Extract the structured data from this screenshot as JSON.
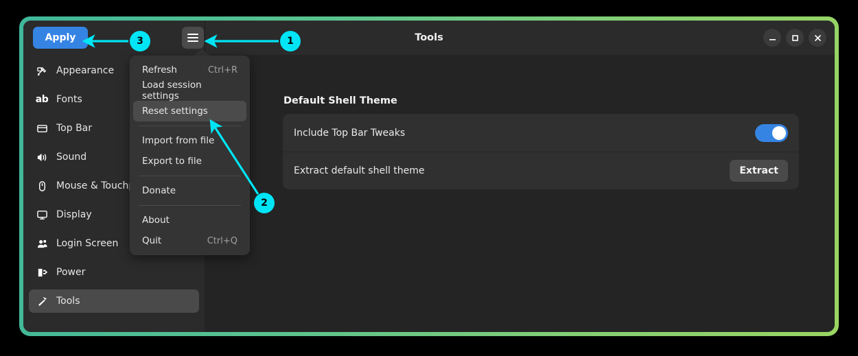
{
  "window": {
    "title": "Tools",
    "controls": [
      {
        "name": "minimize",
        "label": "–"
      },
      {
        "name": "maximize",
        "label": "□"
      },
      {
        "name": "close",
        "label": "✕"
      }
    ]
  },
  "headerbar": {
    "apply_label": "Apply",
    "menu_icon": "hamburger-menu-icon"
  },
  "sidebar": {
    "items": [
      {
        "label": "Appearance",
        "icon": "appearance-icon",
        "selected": false
      },
      {
        "label": "Fonts",
        "icon": "fonts-icon",
        "selected": false
      },
      {
        "label": "Top Bar",
        "icon": "top-bar-icon",
        "selected": false
      },
      {
        "label": "Sound",
        "icon": "sound-icon",
        "selected": false
      },
      {
        "label": "Mouse & Touchp",
        "icon": "mouse-icon",
        "selected": false
      },
      {
        "label": "Display",
        "icon": "display-icon",
        "selected": false
      },
      {
        "label": "Login Screen",
        "icon": "login-screen-icon",
        "selected": false
      },
      {
        "label": "Power",
        "icon": "power-icon",
        "selected": false
      },
      {
        "label": "Tools",
        "icon": "tools-icon",
        "selected": true
      }
    ]
  },
  "content": {
    "section_title": "Default Shell Theme",
    "rows": [
      {
        "label": "Include Top Bar Tweaks",
        "control": "toggle",
        "toggle_on": true
      },
      {
        "label": "Extract default shell theme",
        "control": "button",
        "button_label": "Extract"
      }
    ]
  },
  "menu": {
    "items": [
      {
        "label": "Refresh",
        "accel": "Ctrl+R",
        "highlighted": false
      },
      {
        "label": "Load session settings",
        "accel": "",
        "highlighted": false
      },
      {
        "label": "Reset settings",
        "accel": "",
        "highlighted": true
      },
      {
        "separator": true
      },
      {
        "label": "Import from file",
        "accel": "",
        "highlighted": false
      },
      {
        "label": "Export to file",
        "accel": "",
        "highlighted": false
      },
      {
        "separator": true
      },
      {
        "label": "Donate",
        "accel": "",
        "highlighted": false
      },
      {
        "separator": true
      },
      {
        "label": "About",
        "accel": "",
        "highlighted": false
      },
      {
        "label": "Quit",
        "accel": "Ctrl+Q",
        "highlighted": false
      }
    ]
  },
  "annotations": {
    "accent_color": "#00e5f5",
    "badges": [
      {
        "number": "1",
        "points_to": "hamburger-menu-button"
      },
      {
        "number": "2",
        "points_to": "menu-item-reset-settings"
      },
      {
        "number": "3",
        "points_to": "apply-button"
      }
    ]
  },
  "colors": {
    "accent_blue": "#3584e4",
    "annotation_cyan": "#00e5f5",
    "frame_gradient_start": "#3fb79a",
    "frame_gradient_end": "#9ad562",
    "window_bg": "#242424",
    "sidebar_bg": "#2b2b2b",
    "card_bg": "#303030"
  }
}
